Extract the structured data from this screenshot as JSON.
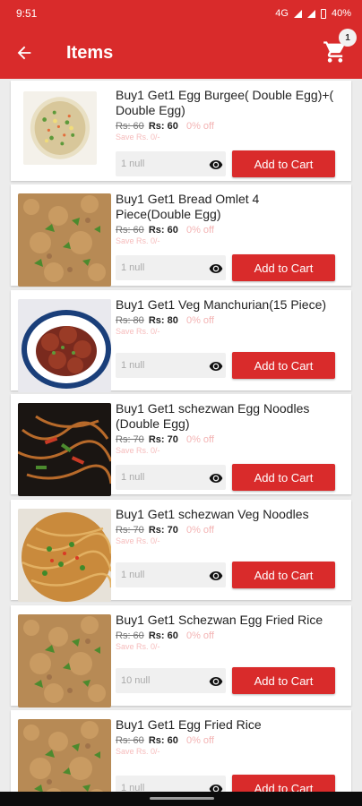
{
  "status_bar": {
    "time": "9:51",
    "network": "4G",
    "battery": "40%"
  },
  "app_bar": {
    "title": "Items",
    "cart_count": "1"
  },
  "items": [
    {
      "name": "Buy1 Get1 Egg Burgee( Double Egg)+( Double Egg)",
      "old_price": "Rs: 60",
      "price": "Rs: 60",
      "discount": "0% off",
      "save": "Save Rs. 0/-",
      "qty": "1 null",
      "button": "Add to Cart",
      "image": "egg-fried-rice-plate"
    },
    {
      "name": "Buy1 Get1 Bread Omlet 4 Piece(Double Egg)",
      "old_price": "Rs: 60",
      "price": "Rs: 60",
      "discount": "0% off",
      "save": "Save Rs. 0/-",
      "qty": "1 null",
      "button": "Add to Cart",
      "image": "fried-rice"
    },
    {
      "name": "Buy1 Get1 Veg Manchurian(15 Piece)",
      "old_price": "Rs: 80",
      "price": "Rs: 80",
      "discount": "0% off",
      "save": "Save Rs. 0/-",
      "qty": "1 null",
      "button": "Add to Cart",
      "image": "manchurian-balls"
    },
    {
      "name": "Buy1 Get1 schezwan Egg Noodles (Double Egg)",
      "old_price": "Rs: 70",
      "price": "Rs: 70",
      "discount": "0% off",
      "save": "Save Rs. 0/-",
      "qty": "1 null",
      "button": "Add to Cart",
      "image": "dark-noodles"
    },
    {
      "name": "Buy1 Get1 schezwan Veg Noodles",
      "old_price": "Rs: 70",
      "price": "Rs: 70",
      "discount": "0% off",
      "save": "Save Rs. 0/-",
      "qty": "1 null",
      "button": "Add to Cart",
      "image": "veg-noodles"
    },
    {
      "name": "Buy1 Get1 Schezwan Egg Fried Rice",
      "old_price": "Rs: 60",
      "price": "Rs: 60",
      "discount": "0% off",
      "save": "Save Rs. 0/-",
      "qty": "10 null",
      "button": "Add to Cart",
      "image": "fried-rice"
    },
    {
      "name": "Buy1 Get1 Egg Fried Rice",
      "old_price": "Rs: 60",
      "price": "Rs: 60",
      "discount": "0% off",
      "save": "Save Rs. 0/-",
      "qty": "1 null",
      "button": "Add to Cart",
      "image": "fried-rice"
    }
  ]
}
